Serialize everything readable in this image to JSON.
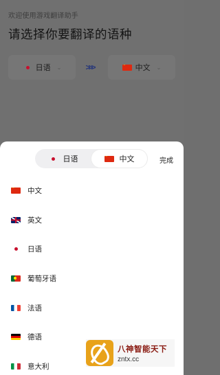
{
  "background": {
    "welcome_text": "欢迎使用游戏翻译助手",
    "headline": "请选择你要翻译的语种",
    "source_picker": {
      "label": "日语",
      "flag": "jp"
    },
    "swap_icon": ">>>",
    "target_picker": {
      "label": "中文",
      "flag": "cn"
    }
  },
  "sheet": {
    "segmented": [
      {
        "label": "日语",
        "flag": "jp",
        "active": false
      },
      {
        "label": "中文",
        "flag": "cn",
        "active": true
      }
    ],
    "done_label": "完成",
    "languages": [
      {
        "label": "中文",
        "flag": "cn"
      },
      {
        "label": "英文",
        "flag": "gb"
      },
      {
        "label": "日语",
        "flag": "jp"
      },
      {
        "label": "葡萄牙语",
        "flag": "pt"
      },
      {
        "label": "法语",
        "flag": "fr"
      },
      {
        "label": "德语",
        "flag": "de"
      },
      {
        "label": "意大利",
        "flag": "it"
      }
    ]
  },
  "watermark": {
    "title": "八神智能天下",
    "url": "zntx.cc"
  }
}
